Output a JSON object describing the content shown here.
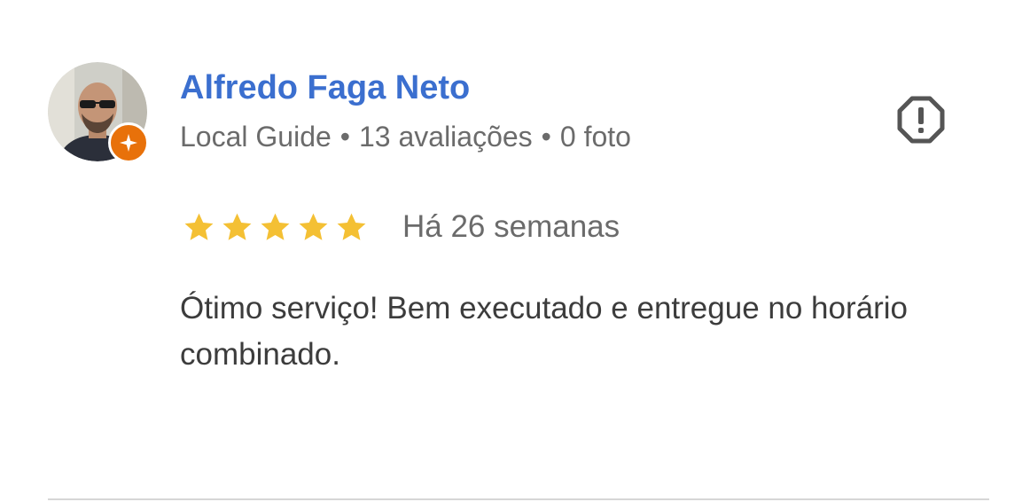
{
  "review": {
    "author_name": "Alfredo Faga Neto",
    "author_level": "Local Guide",
    "separator": "•",
    "review_count": "13 avaliações",
    "photo_count": "0 foto",
    "rating": 5,
    "rating_max": 5,
    "date": "Há 26 semanas",
    "text": "Ótimo serviço! Bem executado e entregue no horário combinado."
  },
  "icons": {
    "avatar": "user-photo",
    "badge": "local-guide-star-icon",
    "report": "report-flag-octagon-icon",
    "star": "star-icon"
  },
  "colors": {
    "author_link": "#3b6fcf",
    "secondary_text": "#6b6b6b",
    "body_text": "#3c3c3c",
    "star_fill": "#f4c034",
    "badge": "#e8710a",
    "icon": "#555555",
    "divider": "#d6d6d6"
  }
}
